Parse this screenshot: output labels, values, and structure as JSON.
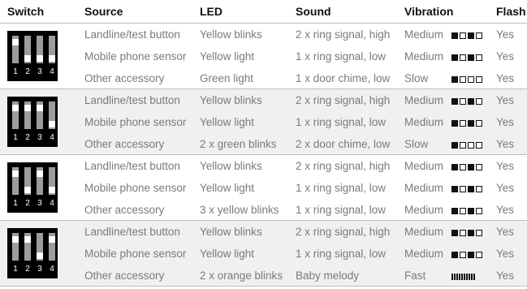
{
  "header": {
    "switch": "Switch",
    "source": "Source",
    "led": "LED",
    "sound": "Sound",
    "vibration": "Vibration",
    "flash": "Flash"
  },
  "switch_numbers": [
    "1",
    "2",
    "3",
    "4"
  ],
  "groups": [
    {
      "switch_positions": [
        "on",
        "off",
        "off",
        "off"
      ],
      "rows": [
        {
          "source": "Landline/test button",
          "led": "Yellow blinks",
          "sound": "2 x ring signal, high",
          "vibration": "Medium",
          "vibration_pattern": "medium",
          "flash": "Yes"
        },
        {
          "source": "Mobile phone sensor",
          "led": "Yellow light",
          "sound": "1 x ring signal, low",
          "vibration": "Medium",
          "vibration_pattern": "medium",
          "flash": "Yes"
        },
        {
          "source": "Other accessory",
          "led": "Green light",
          "sound": "1 x door chime, low",
          "vibration": "Slow",
          "vibration_pattern": "slow",
          "flash": "Yes"
        }
      ]
    },
    {
      "switch_positions": [
        "on",
        "on",
        "on",
        "off"
      ],
      "rows": [
        {
          "source": "Landline/test button",
          "led": "Yellow blinks",
          "sound": "2 x ring signal, high",
          "vibration": "Medium",
          "vibration_pattern": "medium",
          "flash": "Yes"
        },
        {
          "source": "Mobile phone sensor",
          "led": "Yellow light",
          "sound": "1 x ring signal, low",
          "vibration": "Medium",
          "vibration_pattern": "medium",
          "flash": "Yes"
        },
        {
          "source": "Other accessory",
          "led": "2 x green blinks",
          "sound": "2 x door chime, low",
          "vibration": "Slow",
          "vibration_pattern": "slow",
          "flash": "Yes"
        }
      ]
    },
    {
      "switch_positions": [
        "on",
        "off",
        "on",
        "off"
      ],
      "rows": [
        {
          "source": "Landline/test button",
          "led": "Yellow blinks",
          "sound": "2 x ring signal, high",
          "vibration": "Medium",
          "vibration_pattern": "medium",
          "flash": "Yes"
        },
        {
          "source": "Mobile phone sensor",
          "led": "Yellow light",
          "sound": "1 x ring signal, low",
          "vibration": "Medium",
          "vibration_pattern": "medium",
          "flash": "Yes"
        },
        {
          "source": "Other accessory",
          "led": "3 x yellow blinks",
          "sound": "1 x ring signal, low",
          "vibration": "Medium",
          "vibration_pattern": "medium",
          "flash": "Yes"
        }
      ]
    },
    {
      "switch_positions": [
        "on",
        "on",
        "off",
        "on"
      ],
      "rows": [
        {
          "source": "Landline/test button",
          "led": "Yellow blinks",
          "sound": "2 x ring signal, high",
          "vibration": "Medium",
          "vibration_pattern": "medium",
          "flash": "Yes"
        },
        {
          "source": "Mobile phone sensor",
          "led": "Yellow light",
          "sound": "1 x ring signal, low",
          "vibration": "Medium",
          "vibration_pattern": "medium",
          "flash": "Yes"
        },
        {
          "source": "Other accessory",
          "led": "2 x orange blinks",
          "sound": "Baby melody",
          "vibration": "Fast",
          "vibration_pattern": "fast",
          "flash": "Yes"
        }
      ]
    }
  ],
  "colors": {
    "text": "#7a7a7a",
    "header_text": "#111111",
    "shaded_row": "#f0f0f0",
    "divider": "#bdbdbd",
    "switch_body": "#000000",
    "switch_slot": "#9d9d9d"
  }
}
